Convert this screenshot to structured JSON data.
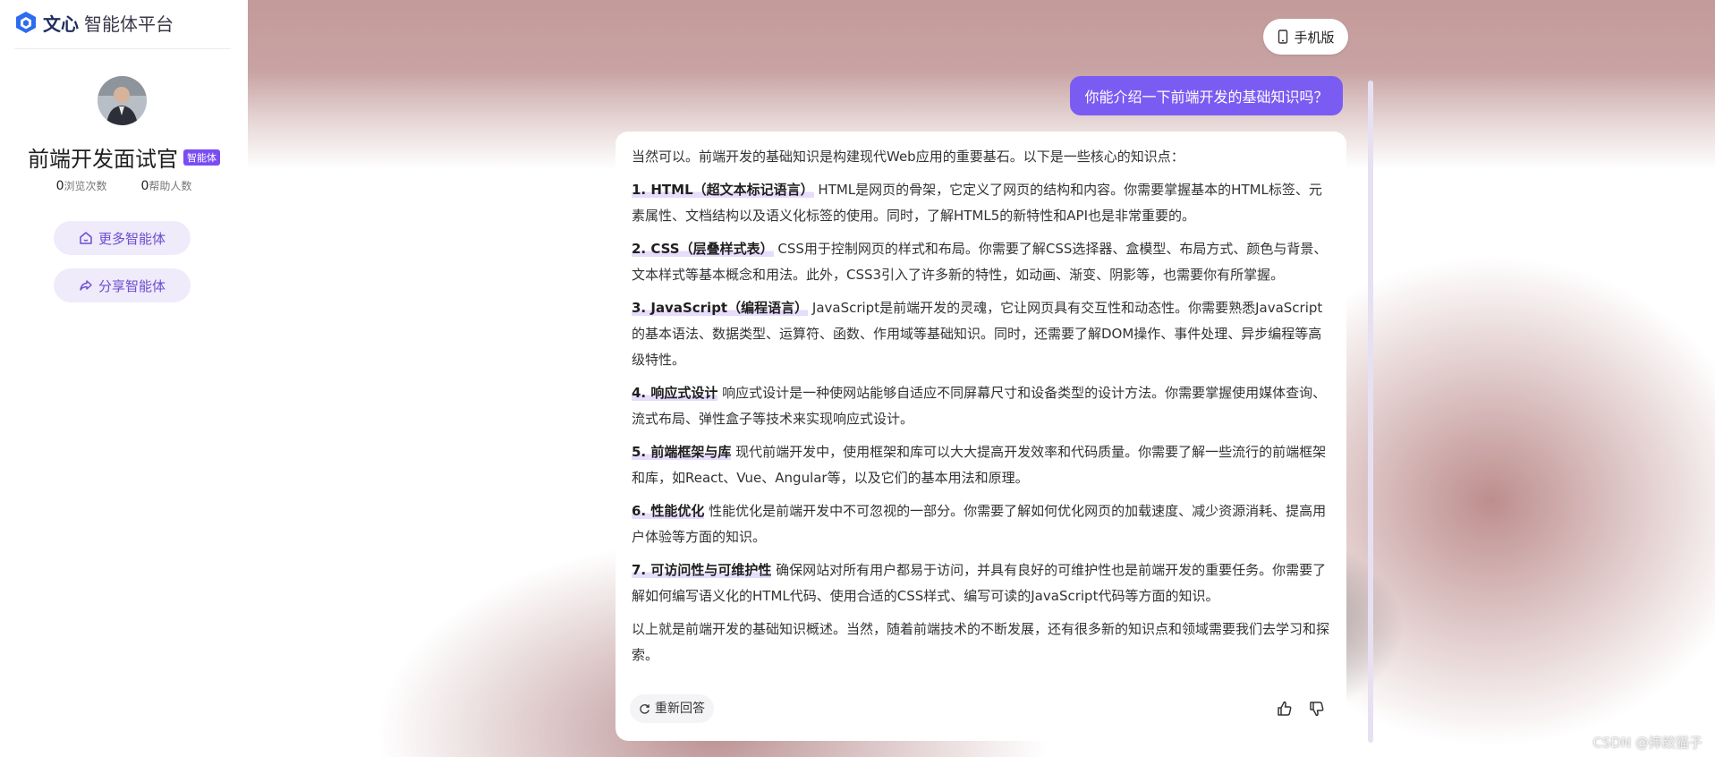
{
  "brand": {
    "bold": "文心",
    "light": "智能体平台"
  },
  "agent": {
    "name": "前端开发面试官",
    "badge": "智能体",
    "views_count": "0",
    "views_label": "浏览次数",
    "helped_count": "0",
    "helped_label": "帮助人数"
  },
  "sidebar_buttons": {
    "more": "更多智能体",
    "share": "分享智能体"
  },
  "header": {
    "mobile_label": "手机版"
  },
  "chat": {
    "user_message": "你能介绍一下前端开发的基础知识吗？",
    "answer": {
      "intro": "当然可以。前端开发的基础知识是构建现代Web应用的重要基石。以下是一些核心的知识点：",
      "items": [
        {
          "title": "1. HTML（超文本标记语言）",
          "body": "HTML是网页的骨架，它定义了网页的结构和内容。你需要掌握基本的HTML标签、元素属性、文档结构以及语义化标签的使用。同时，了解HTML5的新特性和API也是非常重要的。"
        },
        {
          "title": "2. CSS（层叠样式表）",
          "body": "CSS用于控制网页的样式和布局。你需要了解CSS选择器、盒模型、布局方式、颜色与背景、文本样式等基本概念和用法。此外，CSS3引入了许多新的特性，如动画、渐变、阴影等，也需要你有所掌握。"
        },
        {
          "title": "3. JavaScript（编程语言）",
          "body": "JavaScript是前端开发的灵魂，它让网页具有交互性和动态性。你需要熟悉JavaScript的基本语法、数据类型、运算符、函数、作用域等基础知识。同时，还需要了解DOM操作、事件处理、异步编程等高级特性。"
        },
        {
          "title": "4. 响应式设计",
          "body": "响应式设计是一种使网站能够自适应不同屏幕尺寸和设备类型的设计方法。你需要掌握使用媒体查询、流式布局、弹性盒子等技术来实现响应式设计。"
        },
        {
          "title": "5. 前端框架与库",
          "body": "现代前端开发中，使用框架和库可以大大提高开发效率和代码质量。你需要了解一些流行的前端框架和库，如React、Vue、Angular等，以及它们的基本用法和原理。"
        },
        {
          "title": "6. 性能优化",
          "body": "性能优化是前端开发中不可忽视的一部分。你需要了解如何优化网页的加载速度、减少资源消耗、提高用户体验等方面的知识。"
        },
        {
          "title": "7. 可访问性与可维护性",
          "body": "确保网站对所有用户都易于访问，并具有良好的可维护性也是前端开发的重要任务。你需要了解如何编写语义化的HTML代码、使用合适的CSS样式、编写可读的JavaScript代码等方面的知识。"
        }
      ],
      "outro": "以上就是前端开发的基础知识概述。当然，随着前端技术的不断发展，还有很多新的知识点和领域需要我们去学习和探索。"
    },
    "regenerate_label": "重新回答"
  },
  "watermark": "CSDN @摔跤猫子",
  "colors": {
    "accent": "#7b5cf2",
    "accent_light": "#efebfb",
    "badge": "#7a4df2"
  }
}
